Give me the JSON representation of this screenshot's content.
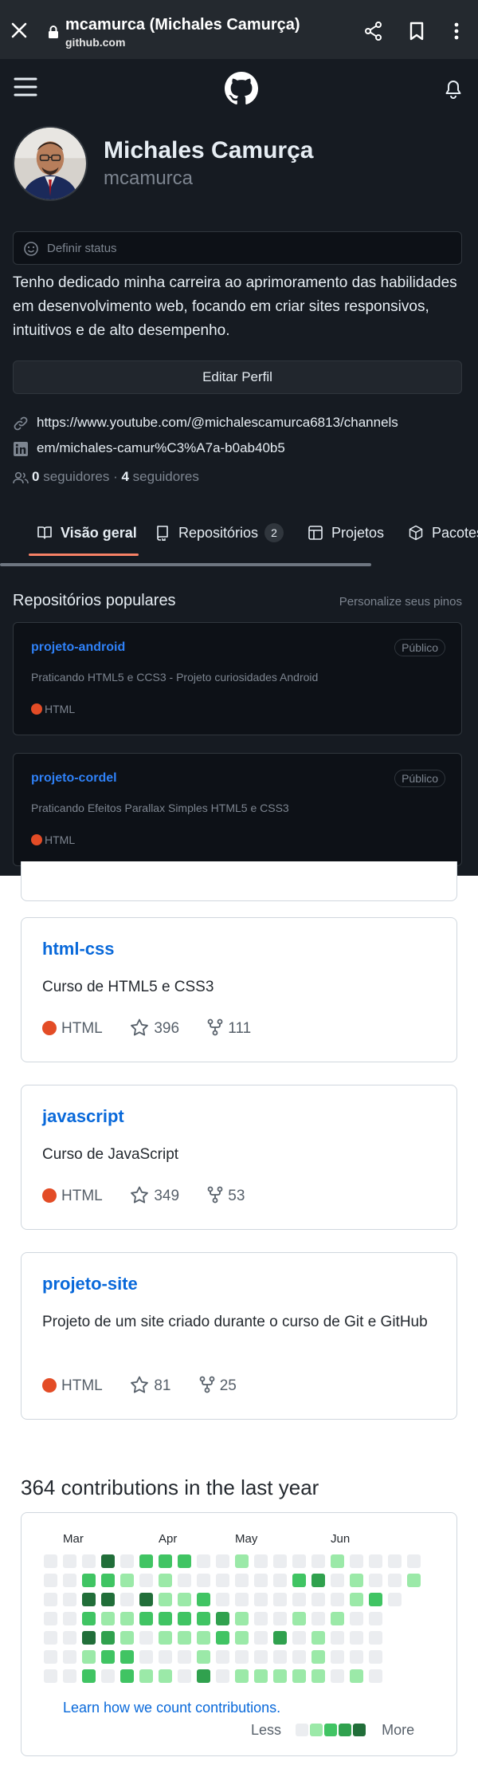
{
  "browser": {
    "title": "mcamurca (Michales Camurça)",
    "url": "github.com",
    "icons": [
      "close-icon",
      "lock-icon",
      "share-icon",
      "bookmark-icon",
      "more-icon"
    ]
  },
  "profile": {
    "full_name": "Michales Camurça",
    "login": "mcamurca",
    "status_placeholder": "Definir status",
    "bio": "Tenho dedicado minha carreira ao aprimoramento das habilidades em desenvolvimento web, focando em criar sites responsivos, intuitivos e de alto desempenho.",
    "edit_button": "Editar Perfil",
    "links": [
      {
        "icon": "link-icon",
        "text": "https://www.youtube.com/@michalescamurca6813/channels"
      },
      {
        "icon": "linkedin-icon",
        "text": "em/michales-camur%C3%A7a-b0ab40b5"
      }
    ],
    "followers_count": "0",
    "followers_label": " seguidores · ",
    "following_count": "4",
    "following_label": " seguidores"
  },
  "tabs": [
    {
      "label": "Visão geral",
      "icon": "book-icon",
      "active": true
    },
    {
      "label": "Repositórios",
      "icon": "repo-icon",
      "counter": "2"
    },
    {
      "label": "Projetos",
      "icon": "table-icon"
    },
    {
      "label": "Pacotes",
      "icon": "package-icon"
    }
  ],
  "popular": {
    "title": "Repositórios populares",
    "customize": "Personalize seus pinos",
    "repos": [
      {
        "name": "projeto-android",
        "visibility": "Público",
        "description": "Praticando HTML5 e CCS3 - Projeto curiosidades Android",
        "language": "HTML"
      },
      {
        "name": "projeto-cordel",
        "visibility": "Público",
        "description": "Praticando Efeitos Parallax Simples HTML5 e CSS3",
        "language": "HTML"
      }
    ]
  },
  "light_repos": [
    {
      "name": "html-css",
      "description": "Curso de HTML5 e CSS3",
      "language": "HTML",
      "stars": "396",
      "forks": "111"
    },
    {
      "name": "javascript",
      "description": "Curso de JavaScript",
      "language": "HTML",
      "stars": "349",
      "forks": "53"
    },
    {
      "name": "projeto-site",
      "description": "Projeto de um site criado durante o curso de Git e GitHub",
      "language": "HTML",
      "stars": "81",
      "forks": "25"
    }
  ],
  "contributions": {
    "title": "364 contributions in the last year",
    "months": [
      "Mar",
      "Apr",
      "May",
      "Jun"
    ],
    "learn_link": "Learn how we count contributions.",
    "legend_less": "Less",
    "legend_more": "More",
    "colors": [
      "#ebedf0",
      "#9be9a8",
      "#40c463",
      "#30a14e",
      "#216e39"
    ],
    "grid": [
      [
        0,
        0,
        0,
        4,
        0,
        2,
        2,
        2,
        0,
        0,
        1,
        0,
        0,
        0,
        0,
        1,
        0,
        0,
        0,
        0
      ],
      [
        0,
        0,
        2,
        2,
        1,
        0,
        1,
        0,
        0,
        0,
        0,
        0,
        0,
        2,
        3,
        0,
        1,
        0,
        0,
        1
      ],
      [
        0,
        0,
        4,
        4,
        0,
        4,
        1,
        1,
        2,
        0,
        0,
        0,
        0,
        0,
        0,
        0,
        1,
        2,
        0
      ],
      [
        0,
        0,
        2,
        1,
        1,
        2,
        2,
        2,
        2,
        3,
        1,
        0,
        0,
        1,
        0,
        1,
        0,
        0
      ],
      [
        0,
        0,
        4,
        3,
        1,
        0,
        1,
        1,
        1,
        2,
        1,
        0,
        3,
        0,
        1,
        0,
        0,
        0
      ],
      [
        0,
        0,
        1,
        2,
        2,
        0,
        0,
        0,
        1,
        0,
        0,
        0,
        0,
        0,
        1,
        0,
        0,
        0
      ],
      [
        0,
        0,
        2,
        0,
        2,
        1,
        1,
        0,
        3,
        0,
        1,
        1,
        1,
        1,
        1,
        0,
        1,
        0
      ]
    ]
  }
}
